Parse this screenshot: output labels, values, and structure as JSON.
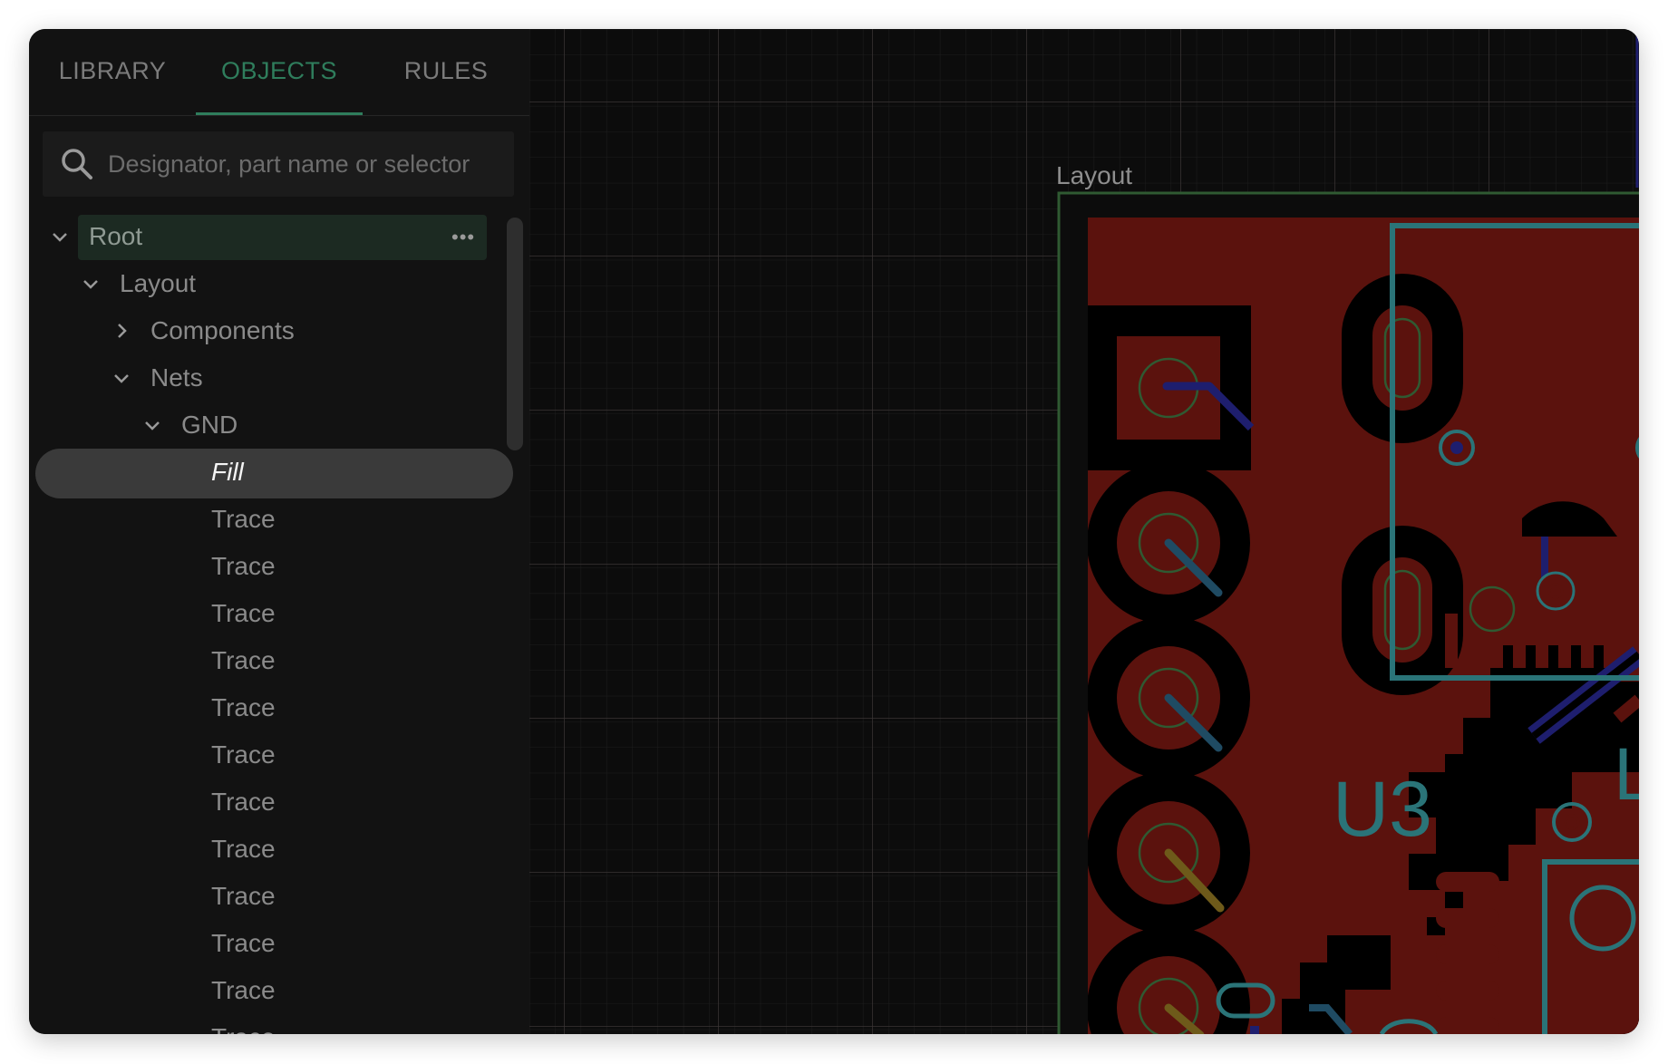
{
  "tabs": [
    {
      "label": "LIBRARY",
      "active": false
    },
    {
      "label": "OBJECTS",
      "active": true
    },
    {
      "label": "RULES",
      "active": false
    }
  ],
  "search": {
    "placeholder": "Designator, part name or selector",
    "value": ""
  },
  "tree": {
    "root": {
      "label": "Root",
      "expanded": true,
      "more_icon": "more-horizontal-icon"
    },
    "layout": {
      "label": "Layout",
      "expanded": true
    },
    "components": {
      "label": "Components",
      "expanded": false
    },
    "nets": {
      "label": "Nets",
      "expanded": true
    },
    "gnd": {
      "label": "GND",
      "expanded": true
    },
    "fill": {
      "label": "Fill",
      "selected": true
    },
    "traces": [
      "Trace",
      "Trace",
      "Trace",
      "Trace",
      "Trace",
      "Trace",
      "Trace",
      "Trace",
      "Trace",
      "Trace",
      "Trace",
      "Trace"
    ]
  },
  "canvas": {
    "board_label": "Layout",
    "designator_label": "U3",
    "partial_label": "L"
  },
  "colors": {
    "accent": "#2f7d5c",
    "board_copper": "#5b120d",
    "silkscreen": "#2a7478",
    "grid": "#3a3434",
    "background": "#0c0c0c"
  }
}
